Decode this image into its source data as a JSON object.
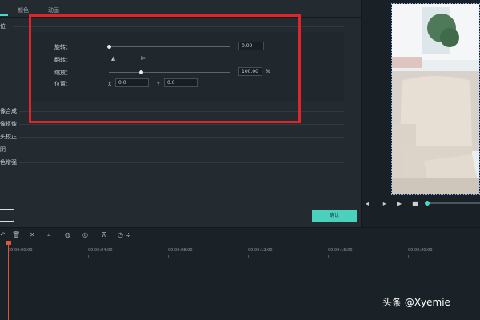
{
  "tabs": [
    "",
    "颜色",
    "动画"
  ],
  "left_sections": {
    "top_label": "位",
    "items": [
      "像合成",
      "像抠像",
      "头校正",
      "阴",
      "色增强"
    ]
  },
  "transform": {
    "rotate": {
      "label": "旋转：",
      "value": "0.00",
      "slider_fraction": 0.0
    },
    "flip": {
      "label": "翻转："
    },
    "scale": {
      "label": "缩放：",
      "value": "100.00",
      "unit": "%",
      "slider_fraction": 0.26
    },
    "position": {
      "label": "位置：",
      "x_label": "X",
      "x_value": "0.0",
      "y_label": "Y",
      "y_value": "0.0"
    }
  },
  "buttons": {
    "confirm": "确认"
  },
  "timeline": {
    "timestamps": [
      "00:00:00:00",
      "00:00:04:00",
      "00:00:08:00",
      "00:00:12:00",
      "00:00:16:00",
      "00:00:20:00"
    ]
  },
  "watermark": "头条 @Xyemie",
  "colors": {
    "accent": "#4cd7c3",
    "highlight_frame": "#e0242a",
    "playhead": "#e0543a"
  }
}
